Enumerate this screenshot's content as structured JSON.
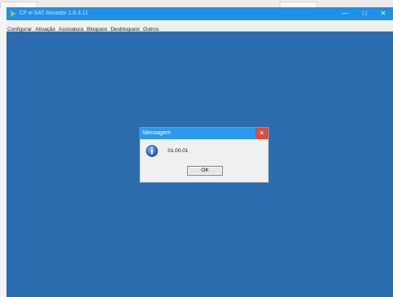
{
  "window": {
    "title": "CF-e-SAT Ativador 1.8.3.11",
    "minimize_glyph": "—",
    "maximize_glyph": "□",
    "close_glyph": "✕"
  },
  "menubar": {
    "items": [
      "Configurar",
      "Ativação",
      "Assinatura",
      "Bloqueio",
      "Desbloqueio",
      "Outros"
    ]
  },
  "dialog": {
    "title": "Mensagem",
    "close_glyph": "✕",
    "message": "01.00.01",
    "ok_label": "OK",
    "icon": "info-icon"
  },
  "colors": {
    "desktop": "#2b6cad",
    "titlebar": "#1e90e8",
    "dialog_titlebar": "#2a9af0",
    "close_red": "#e04a3a"
  }
}
